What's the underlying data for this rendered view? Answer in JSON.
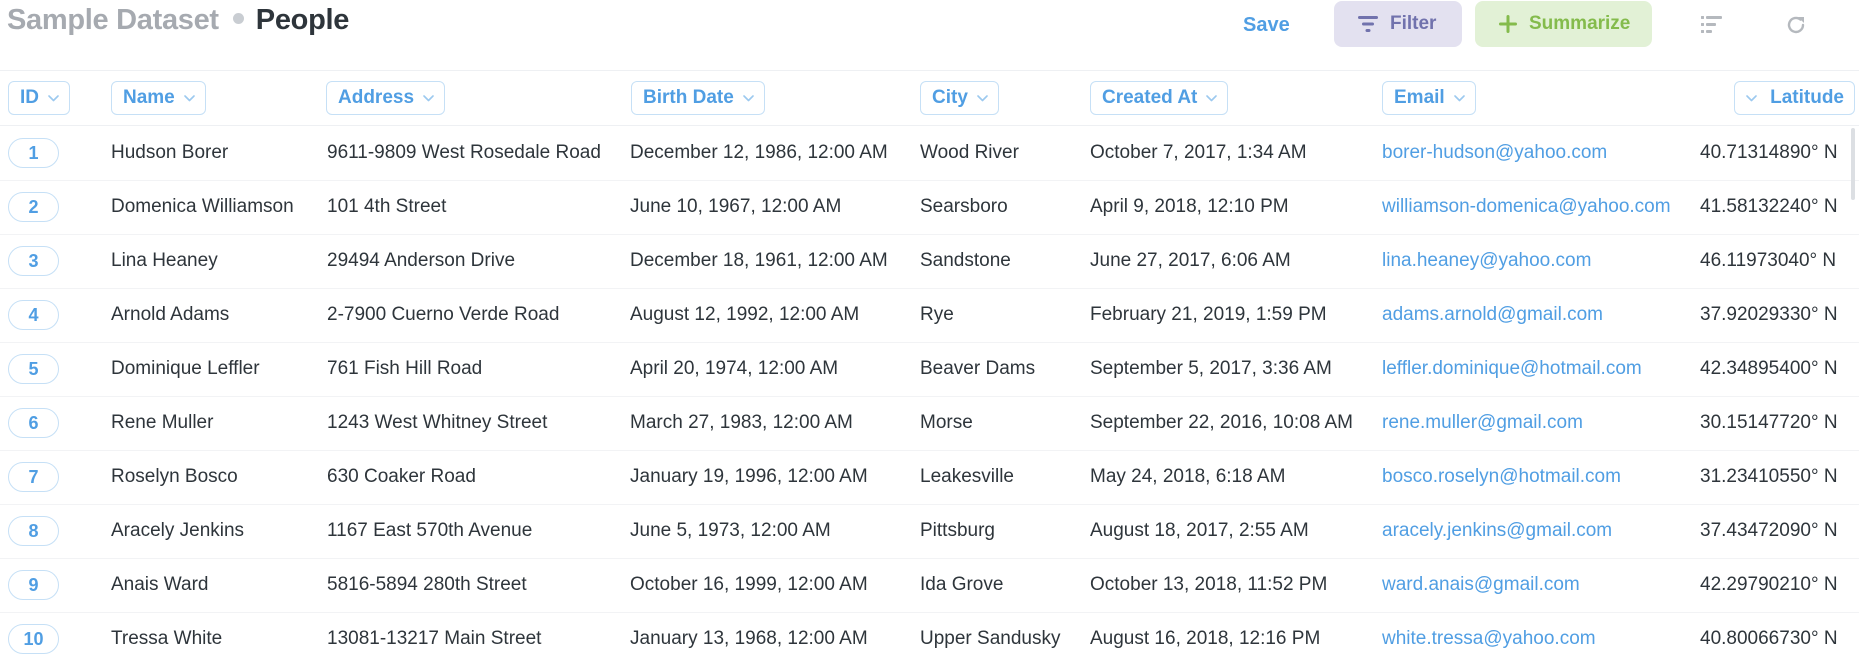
{
  "header": {
    "crumb": "Sample Dataset",
    "title": "People",
    "save_label": "Save",
    "filter_label": "Filter",
    "summarize_label": "Summarize"
  },
  "colors": {
    "accent": "#509ee3",
    "filter_bg": "#e3e1f0",
    "filter_fg": "#7172ad",
    "summarize_bg": "#e2f1d6",
    "summarize_fg": "#84bb4c"
  },
  "icons": [
    "filter-icon",
    "plus-icon",
    "list-icon",
    "refresh-icon",
    "chevron-down-icon"
  ],
  "table": {
    "columns": [
      "ID",
      "Name",
      "Address",
      "Birth Date",
      "City",
      "Created At",
      "Email",
      "Latitude"
    ],
    "rows": [
      [
        "1",
        "Hudson Borer",
        "9611-9809 West Rosedale Road",
        "December 12, 1986, 12:00 AM",
        "Wood River",
        "October 7, 2017, 1:34 AM",
        "borer-hudson@yahoo.com",
        "40.71314890° N"
      ],
      [
        "2",
        "Domenica Williamson",
        "101 4th Street",
        "June 10, 1967, 12:00 AM",
        "Searsboro",
        "April 9, 2018, 12:10 PM",
        "williamson-domenica@yahoo.com",
        "41.58132240° N"
      ],
      [
        "3",
        "Lina Heaney",
        "29494 Anderson Drive",
        "December 18, 1961, 12:00 AM",
        "Sandstone",
        "June 27, 2017, 6:06 AM",
        "lina.heaney@yahoo.com",
        "46.11973040° N"
      ],
      [
        "4",
        "Arnold Adams",
        "2-7900 Cuerno Verde Road",
        "August 12, 1992, 12:00 AM",
        "Rye",
        "February 21, 2019, 1:59 PM",
        "adams.arnold@gmail.com",
        "37.92029330° N"
      ],
      [
        "5",
        "Dominique Leffler",
        "761 Fish Hill Road",
        "April 20, 1974, 12:00 AM",
        "Beaver Dams",
        "September 5, 2017, 3:36 AM",
        "leffler.dominique@hotmail.com",
        "42.34895400° N"
      ],
      [
        "6",
        "Rene Muller",
        "1243 West Whitney Street",
        "March 27, 1983, 12:00 AM",
        "Morse",
        "September 22, 2016, 10:08 AM",
        "rene.muller@gmail.com",
        "30.15147720° N"
      ],
      [
        "7",
        "Roselyn Bosco",
        "630 Coaker Road",
        "January 19, 1996, 12:00 AM",
        "Leakesville",
        "May 24, 2018, 6:18 AM",
        "bosco.roselyn@hotmail.com",
        "31.23410550° N"
      ],
      [
        "8",
        "Aracely Jenkins",
        "1167 East 570th Avenue",
        "June 5, 1973, 12:00 AM",
        "Pittsburg",
        "August 18, 2017, 2:55 AM",
        "aracely.jenkins@gmail.com",
        "37.43472090° N"
      ],
      [
        "9",
        "Anais Ward",
        "5816-5894 280th Street",
        "October 16, 1999, 12:00 AM",
        "Ida Grove",
        "October 13, 2018, 11:52 PM",
        "ward.anais@gmail.com",
        "42.29790210° N"
      ],
      [
        "10",
        "Tressa White",
        "13081-13217 Main Street",
        "January 13, 1968, 12:00 AM",
        "Upper Sandusky",
        "August 16, 2018, 12:16 PM",
        "white.tressa@yahoo.com",
        "40.80066730° N"
      ]
    ]
  }
}
